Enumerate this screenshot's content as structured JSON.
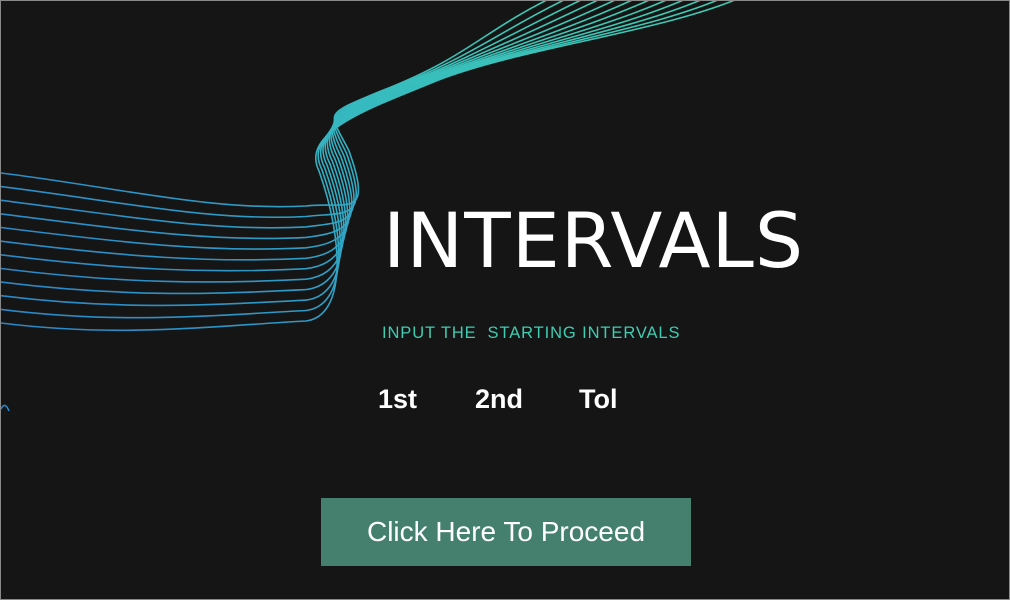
{
  "app": {
    "title": "INTERVALS",
    "subtitle": "INPUT THE  STARTING INTERVALS",
    "fields": {
      "first_label": "1st",
      "second_label": "2nd",
      "tolerance_label": "Tol"
    },
    "proceed_button_label": "Click Here To Proceed"
  },
  "decoration": {
    "icon": "wave-lines-graphic",
    "accent_color": "#3fcdb2",
    "secondary_color": "#2a86c8"
  },
  "colors": {
    "background": "#151515",
    "title": "#ffffff",
    "subtitle": "#3fcdb2",
    "button": "#45806f"
  }
}
